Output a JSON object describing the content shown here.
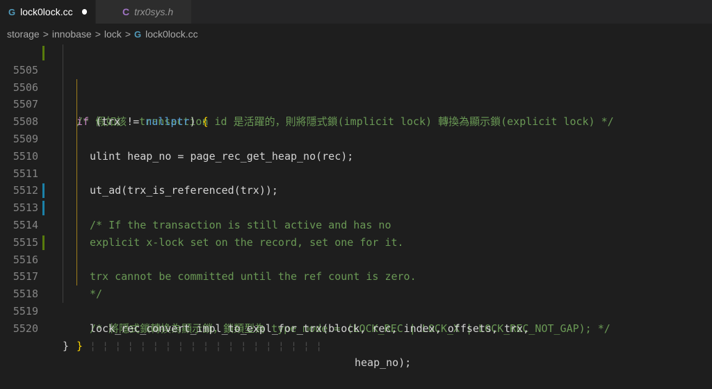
{
  "tabs": [
    {
      "icon": "C",
      "label": "lock0lock.cc"
    },
    {
      "icon": "C",
      "label": "trx0sys.h"
    }
  ],
  "breadcrumb": {
    "items": [
      "storage",
      "innobase",
      "lock",
      "lock0lock.cc"
    ],
    "separator": ">",
    "file_icon": "G"
  },
  "lines": [
    {
      "num": "5505",
      "text": "/* 假如該  transaction id 是活躍的，則將隱式鎖(implicit lock) 轉換為顯示鎖(explicit lock) */"
    },
    {
      "num": "5506",
      "kw": "if",
      "pre": " (trx != ",
      "nul": "nullptr",
      "post": ") ",
      "br": "{"
    },
    {
      "num": "5507",
      "text": "ulint heap_no = page_rec_get_heap_no(rec);"
    },
    {
      "num": "5508",
      "text": ""
    },
    {
      "num": "5509",
      "text": "ut_ad(trx_is_referenced(trx));"
    },
    {
      "num": "5510",
      "text": ""
    },
    {
      "num": "5511",
      "text": "/* If the transaction is still active and has no"
    },
    {
      "num": "5512",
      "text": "explicit x-lock set on the record, set one for it."
    },
    {
      "num": "5513",
      "text": "trx cannot be committed until the ref count is zero."
    },
    {
      "num": "5514",
      "text": "*/"
    },
    {
      "num": "5515",
      "text": ""
    },
    {
      "num": "5516",
      "text": "/* 將隱式鎖轉換為顯示鎖，鎖類型為 type_mode = (LOCK_REC | LOCK_X | LOCK_REC_NOT_GAP); */"
    },
    {
      "num": "5517",
      "text": "lock_rec_convert_impl_to_expl_for_trx(block, rec, index, offsets, trx,"
    },
    {
      "num": "5518",
      "ws": "¦ ¦ ¦ ¦ ¦ ¦ ¦ ¦ ¦ ¦ ¦ ¦ ¦ ¦ ¦ ¦ ¦ ¦ ¦",
      "text": "heap_no);"
    },
    {
      "num": "5519",
      "text": "}"
    },
    {
      "num": "5520",
      "text": "}"
    }
  ],
  "colors": {
    "background": "#1e1e1e",
    "comment": "#6a9955",
    "keyword": "#c586c0",
    "null_keyword": "#569cd6",
    "bracket": "#ffd700",
    "added_line": "#587c0c",
    "modified_line": "#1b81a8"
  },
  "icons": {
    "cpp_file": "cpp-file-icon",
    "c_file": "c-file-icon",
    "unsaved": "unsaved-dot-icon"
  }
}
